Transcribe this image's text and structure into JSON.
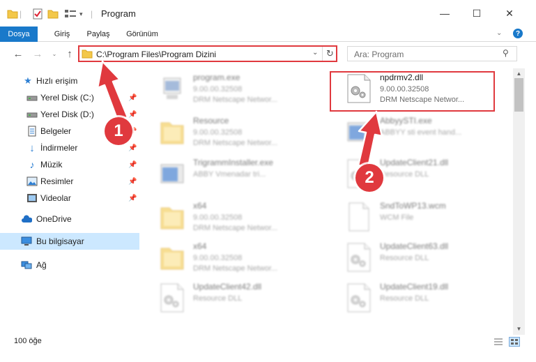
{
  "window": {
    "title": "Program",
    "minimize": "—",
    "maximize": "☐",
    "close": "✕"
  },
  "ribbon": {
    "tabs": [
      "Dosya",
      "Giriş",
      "Paylaş",
      "Görünüm"
    ]
  },
  "nav": {
    "address": "C:\\Program Files\\Program Dizini",
    "search_placeholder": "Ara: Program"
  },
  "sidebar": {
    "items": [
      {
        "label": "Hızlı erişim",
        "icon": "star-icon"
      },
      {
        "label": "Yerel Disk (C:)",
        "icon": "drive-icon"
      },
      {
        "label": "Yerel Disk (D:)",
        "icon": "drive-icon"
      },
      {
        "label": "Belgeler",
        "icon": "documents-icon"
      },
      {
        "label": "İndirmeler",
        "icon": "download-icon"
      },
      {
        "label": "Müzik",
        "icon": "music-icon"
      },
      {
        "label": "Resimler",
        "icon": "pictures-icon"
      },
      {
        "label": "Videolar",
        "icon": "videos-icon"
      },
      {
        "label": "OneDrive",
        "icon": "cloud-icon"
      },
      {
        "label": "Bu bilgisayar",
        "icon": "computer-icon"
      },
      {
        "label": "Ağ",
        "icon": "network-icon"
      }
    ]
  },
  "files": [
    {
      "name": "program.exe",
      "l1": "9.00.00.32508",
      "l2": "DRM Netscape Networ...",
      "kind": "exe"
    },
    {
      "name": "npdrmv2.dll",
      "l1": "9.00.00.32508",
      "l2": "DRM Netscape Networ...",
      "kind": "dll"
    },
    {
      "name": "Resource",
      "l1": "9.00.00.32508",
      "l2": "DRM Netscape Networ...",
      "kind": "folder"
    },
    {
      "name": "AbbyySTI.exe",
      "l1": "ABBYY sti event hand...",
      "l2": "",
      "kind": "exe2"
    },
    {
      "name": "TrigrammInstaller.exe",
      "l1": "ABBY Vmenadar tri...",
      "l2": "",
      "kind": "exe2"
    },
    {
      "name": "UpdateClient21.dll",
      "l1": "Resource DLL",
      "l2": "",
      "kind": "dll"
    },
    {
      "name": "x64",
      "l1": "9.00.00.32508",
      "l2": "DRM Netscape Networ...",
      "kind": "folder"
    },
    {
      "name": "SndToWP13.wcm",
      "l1": "WCM File",
      "l2": "",
      "kind": "blank"
    },
    {
      "name": "x64",
      "l1": "9.00.00.32508",
      "l2": "DRM Netscape Networ...",
      "kind": "folder"
    },
    {
      "name": "UpdateClient63.dll",
      "l1": "Resource DLL",
      "l2": "",
      "kind": "dll"
    },
    {
      "name": "UpdateClient42.dll",
      "l1": "Resource DLL",
      "l2": "",
      "kind": "dll"
    },
    {
      "name": "UpdateClient19.dll",
      "l1": "Resource DLL",
      "l2": "",
      "kind": "dll"
    }
  ],
  "status": {
    "count": "100 öğe"
  },
  "annotations": {
    "one": "1",
    "two": "2"
  },
  "colors": {
    "accent": "#1979ca",
    "highlight_red": "#e0393e",
    "selection": "#cce8ff"
  }
}
